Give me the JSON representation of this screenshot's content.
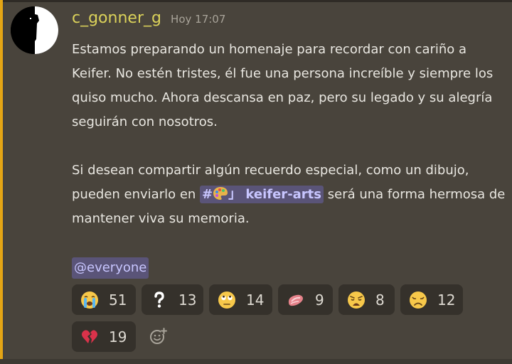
{
  "message": {
    "author": "c_gonner_g",
    "timestamp": "Hoy 17:07",
    "paragraph1": "Estamos preparando un homenaje para recordar con cariño a Keifer. No estén tristes, él fue una persona increíble y siempre los quiso mucho. Ahora descansa en paz, pero su legado y su alegría seguirán con nosotros.",
    "paragraph2_before": "Si desean compartir algún recuerdo especial, como un dibujo, pueden enviarlo en ",
    "channel_hash": "#",
    "channel_name": "」 keifer-arts",
    "paragraph2_after": " será una forma hermosa de mantener viva su memoria.",
    "mention": "@everyone"
  },
  "reactions": [
    {
      "emoji": "loudly-crying-face",
      "count": "51"
    },
    {
      "emoji": "question-mark",
      "count": "13"
    },
    {
      "emoji": "face-with-rolling-eyes",
      "count": "14"
    },
    {
      "emoji": "raw-meat",
      "count": "9"
    },
    {
      "emoji": "weary-face",
      "count": "8"
    },
    {
      "emoji": "disappointed-face",
      "count": "12"
    },
    {
      "emoji": "broken-heart",
      "count": "19"
    }
  ],
  "colors": {
    "background": "#49443c",
    "accent": "#e4a515",
    "username": "#dbd25a",
    "mention_bg": "#5a5478",
    "reaction_bg": "#35312b"
  }
}
